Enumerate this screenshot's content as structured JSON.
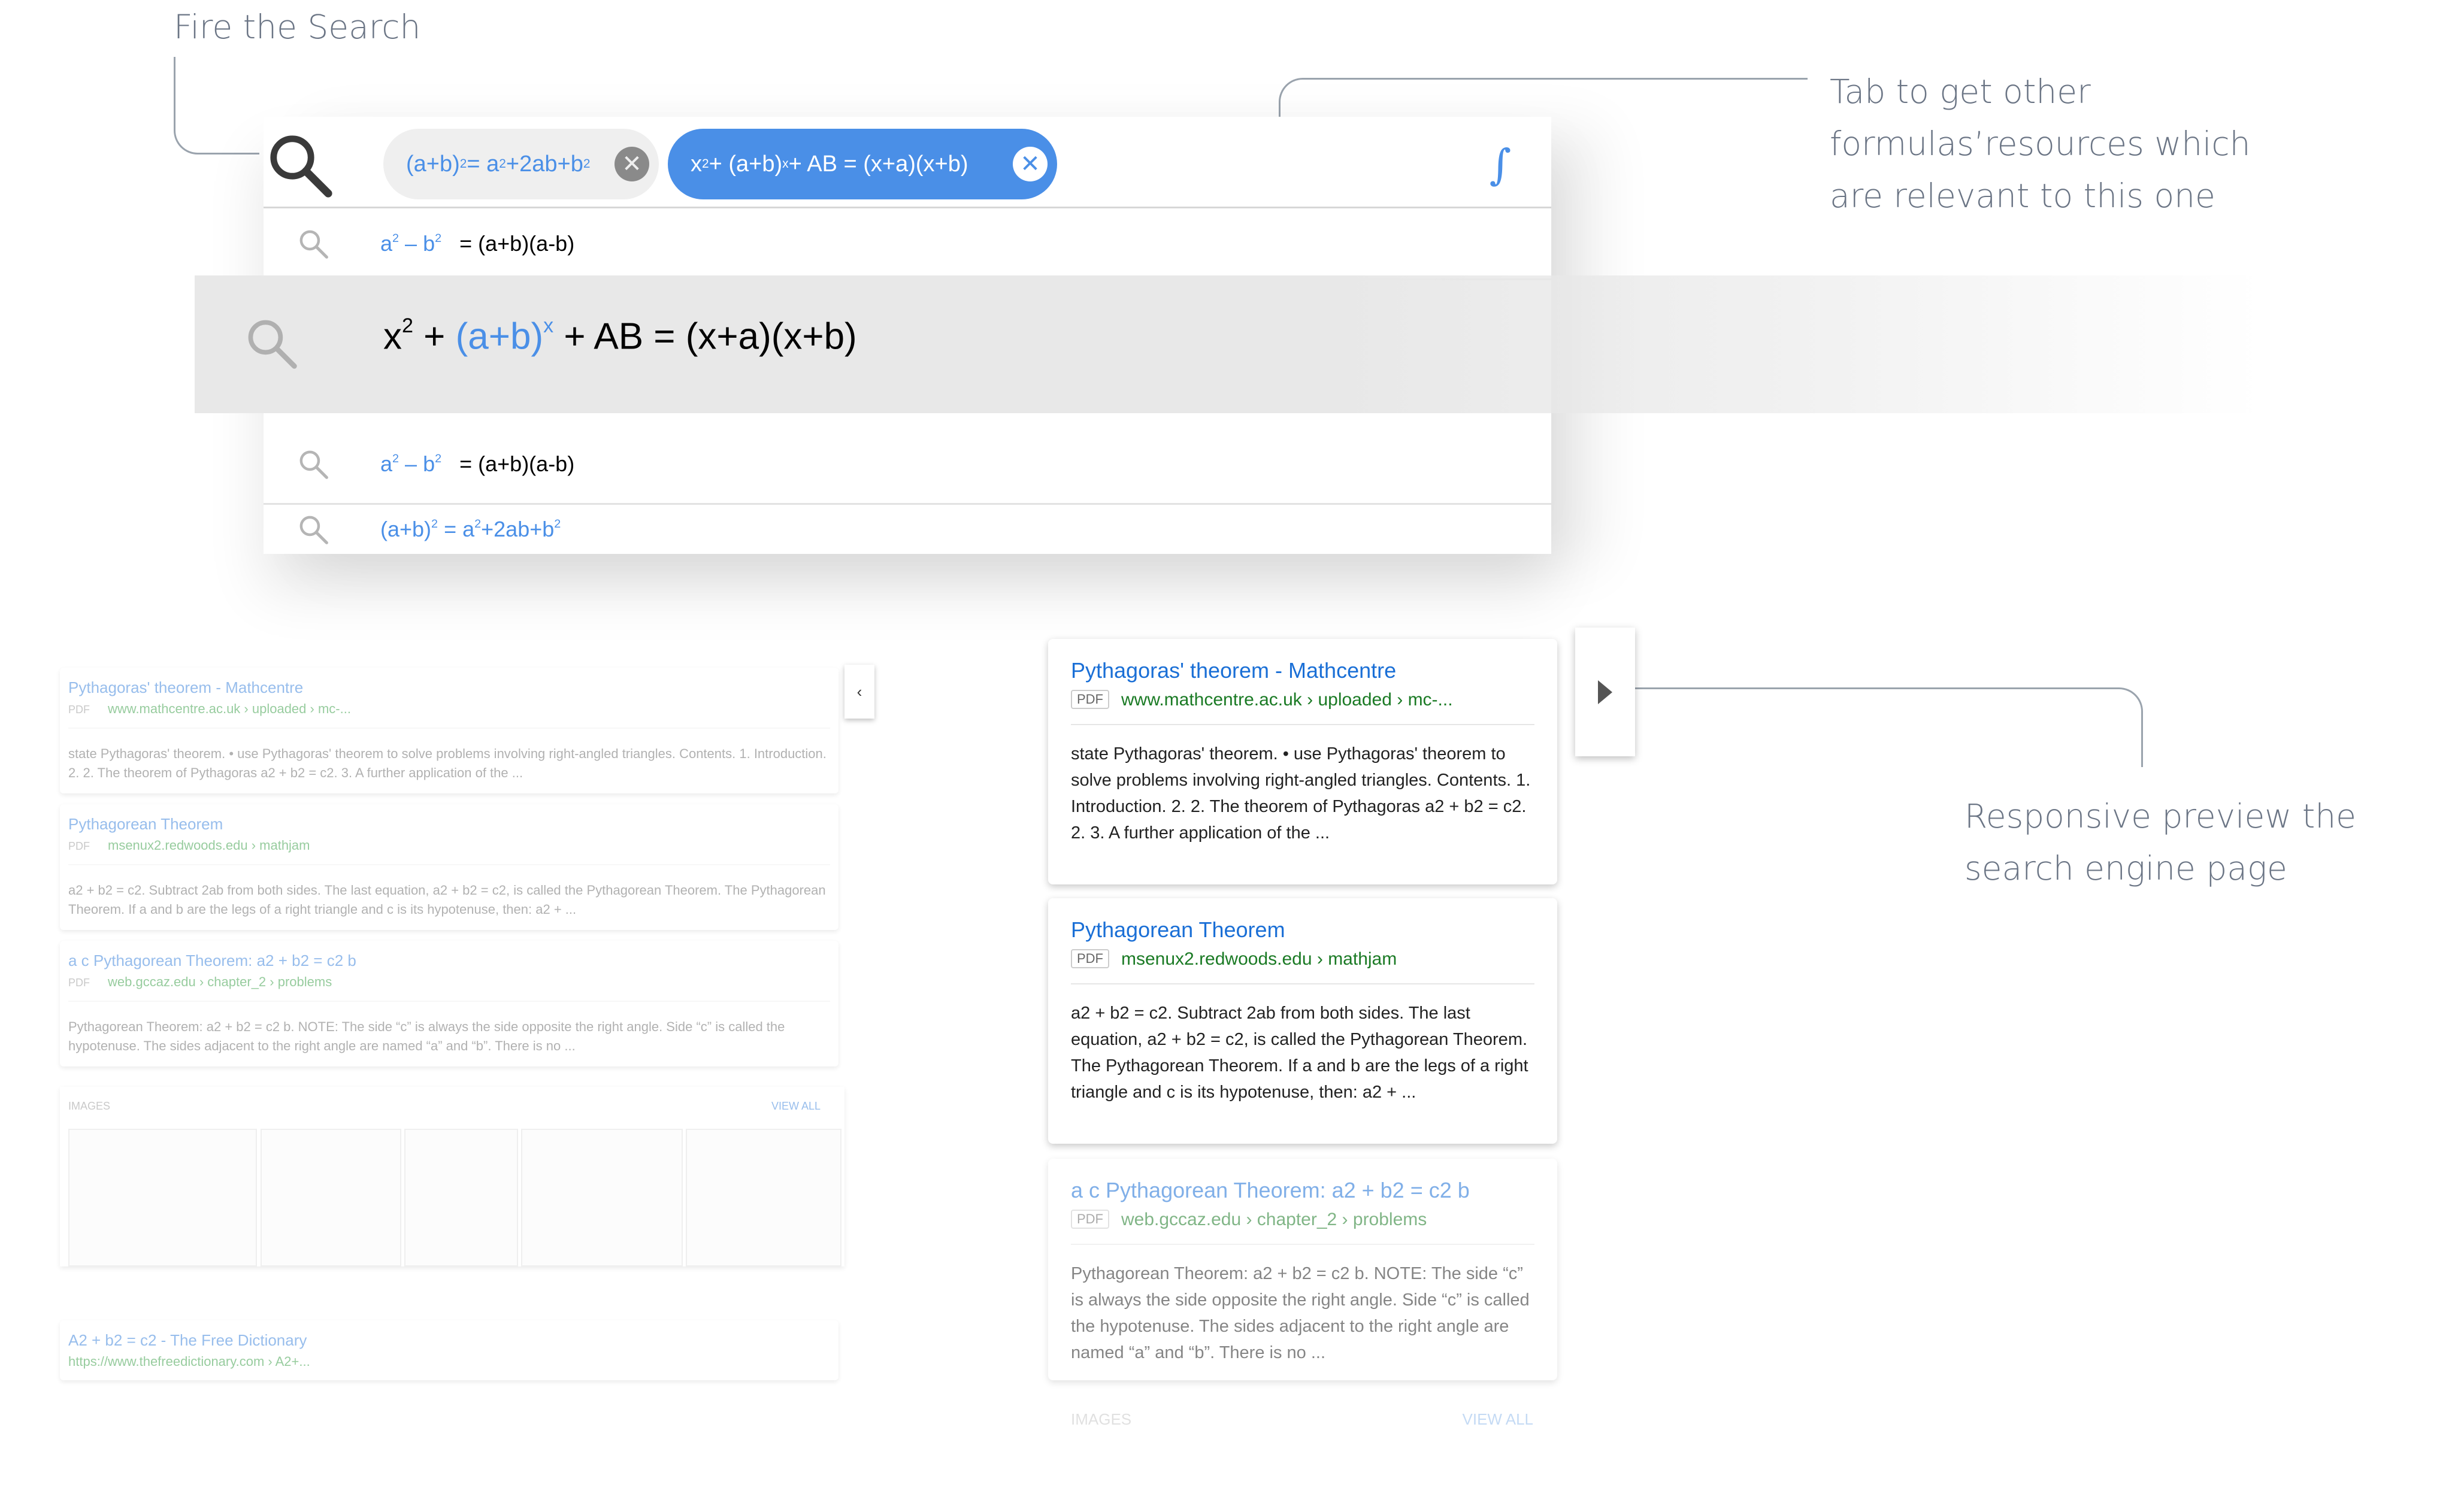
{
  "annotations": {
    "fire_search": "Fire the Search",
    "tab_resources": [
      "Tab to get other",
      "formulas’resources which",
      "are relevant to this one"
    ],
    "responsive_preview": [
      "Responsive preview the",
      "search engine page"
    ]
  },
  "search": {
    "chips": [
      {
        "base": "(a+b)",
        "exp": "2",
        "mid": " = a",
        "exp2": "2",
        "tail": "+2ab+b",
        "exp3": "2"
      },
      {
        "p1": "x",
        "e1": "2",
        "p2": " + (a+b)",
        "e2": "x",
        "p3": " + AB = (x+a)(x+b)"
      }
    ],
    "close_glyph": "✕",
    "formula_icon": "∫",
    "suggestions": [
      {
        "a": "a",
        "ea": "2",
        "b": " – b",
        "eb": "2",
        "rest": "   = (a+b)(a-b)"
      },
      {
        "x": "x",
        "ex": "2",
        "p": " + ",
        "ab": "(a+b)",
        "eab": "x",
        "rest": " + AB = (x+a)(x+b)"
      },
      {
        "a": "a",
        "ea": "2",
        "b": " – b",
        "eb": "2",
        "rest": "   = (a+b)(a-b)"
      },
      {
        "base": "(a+b)",
        "e": "2",
        "mid": " = a",
        "e2": "2",
        "tail": "+2ab+b",
        "e3": "2"
      }
    ]
  },
  "left_preview": {
    "results": [
      {
        "title": "Pythagoras' theorem - Mathcentre",
        "pdf": "PDF",
        "url": "www.mathcentre.ac.uk › uploaded › mc-...",
        "snippet": "state Pythagoras' theorem. • use Pythagoras' theorem to solve problems involving right-angled triangles. Contents. 1. Introduction. 2. 2. The theorem of Pythagoras a2 + b2 = c2. 3. A further application of the ..."
      },
      {
        "title": "Pythagorean Theorem",
        "pdf": "PDF",
        "url": "msenux2.redwoods.edu › mathjam",
        "snippet": "a2 + b2 = c2. Subtract 2ab from both sides. The last equation, a2 + b2 = c2, is called the Pythagorean Theorem. The Pythagorean Theorem. If a and b are the legs of a right triangle and c is its hypotenuse, then: a2 + ..."
      },
      {
        "title": "a c Pythagorean Theorem: a2 + b2 = c2 b",
        "pdf": "PDF",
        "url": "web.gccaz.edu › chapter_2 › problems",
        "snippet": "Pythagorean Theorem: a2 + b2 = c2 b. NOTE: The side “c” is always the side opposite the right angle. Side “c” is called the hypotenuse. The sides adjacent to the right angle are named “a” and “b”. There is no ..."
      }
    ],
    "images_label": "IMAGES",
    "view_all": "VIEW ALL",
    "extra": {
      "title": "A2 + b2 = c2 - The Free Dictionary",
      "url": "https://www.thefreedictionary.com › A2+..."
    },
    "collapse_glyph": "‹"
  },
  "right_preview": {
    "results": [
      {
        "title": "Pythagoras' theorem - Mathcentre",
        "pdf": "PDF",
        "url": "www.mathcentre.ac.uk › uploaded › mc-...",
        "snippet": "state Pythagoras' theorem. • use Pythagoras' theorem to solve problems involving right-angled triangles. Contents. 1. Introduction. 2. 2. The theorem of Pythagoras a2 + b2 = c2. 2. 3. A further application of the ..."
      },
      {
        "title": "Pythagorean Theorem",
        "pdf": "PDF",
        "url": "msenux2.redwoods.edu › mathjam",
        "snippet": "a2 + b2 = c2. Subtract 2ab from both sides. The last equation, a2 + b2 = c2, is called the Pythagorean Theorem. The Pythagorean Theorem. If a and b are the legs of a right triangle and c is its hypotenuse, then: a2 + ..."
      },
      {
        "title": "a c Pythagorean Theorem: a2 + b2 = c2 b",
        "pdf": "PDF",
        "url": "web.gccaz.edu › chapter_2 › problems",
        "snippet": "Pythagorean Theorem: a2 + b2 = c2 b. NOTE: The side “c” is always the side opposite the right angle. Side “c” is called the hypotenuse. The sides adjacent to the right angle are named “a” and “b”. There is no ..."
      }
    ],
    "images_label": "IMAGES",
    "view_all": "VIEW ALL"
  },
  "colors": {
    "accent": "#4a8fe7",
    "link": "#1a6fd6",
    "url_green": "#1a7a24",
    "annotation": "#6b7585"
  }
}
